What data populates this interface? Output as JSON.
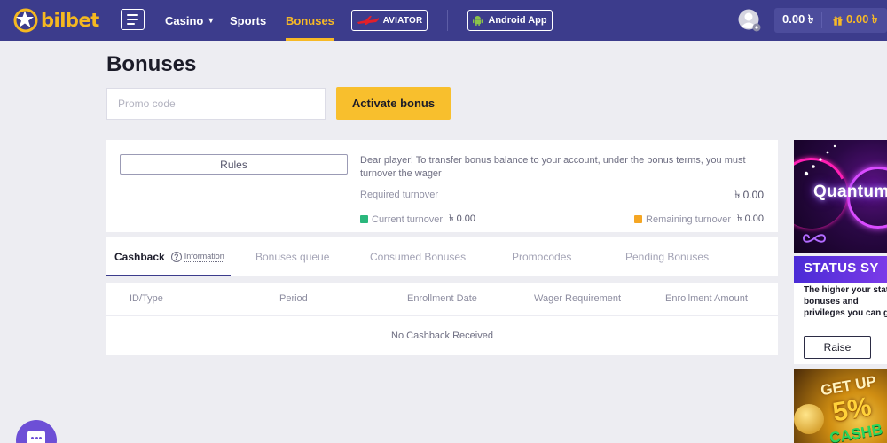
{
  "header": {
    "logo_text": "bilbet",
    "nav": {
      "casino": "Casino",
      "sports": "Sports",
      "bonuses": "Bonuses"
    },
    "aviator_label": "AVIATOR",
    "android_label": "Android App",
    "balance": "0.00 ৳",
    "bonus_balance": "0.00 ৳"
  },
  "page": {
    "title": "Bonuses",
    "promo_placeholder": "Promo code",
    "activate_label": "Activate bonus"
  },
  "rules": {
    "button_label": "Rules",
    "note": "Dear player! To transfer bonus balance to your account, under the bonus terms, you must turnover the wager",
    "required_label": "Required turnover",
    "required_value": "৳ 0.00",
    "current_label": "Current turnover",
    "current_value": "৳ 0.00",
    "remaining_label": "Remaining turnover",
    "remaining_value": "৳ 0.00"
  },
  "tabs": {
    "cashback": "Cashback",
    "info_label": "Information",
    "queue": "Bonuses queue",
    "consumed": "Consumed Bonuses",
    "promocodes": "Promocodes",
    "pending": "Pending Bonuses"
  },
  "table": {
    "columns": [
      "ID/Type",
      "Period",
      "Enrollment Date",
      "Wager Requirement",
      "Enrollment Amount"
    ],
    "empty_message": "No Cashback Received"
  },
  "banners": {
    "quantum_title": "Quantum",
    "status_title": "STATUS SY",
    "status_text": "The higher your status bonuses and privileges you can get",
    "raise_label": "Raise",
    "cashback_line1": "GET UP",
    "cashback_line2": "5%",
    "cashback_line3": "CASHB"
  },
  "colors": {
    "header_bg": "#3c3c8c",
    "accent": "#f7b926",
    "activate_button": "#f8bf2d",
    "page_bg": "#ededf2",
    "chat_button": "#6d4fd6"
  },
  "icons": {
    "logo": "bilbet-star-logo-icon",
    "menu": "hamburger-menu-icon",
    "aviator": "aviator-plane-icon",
    "android": "android-icon",
    "avatar": "user-avatar-icon",
    "gift": "gift-icon",
    "info": "info-circle-icon",
    "chat": "chat-bubble-icon"
  }
}
